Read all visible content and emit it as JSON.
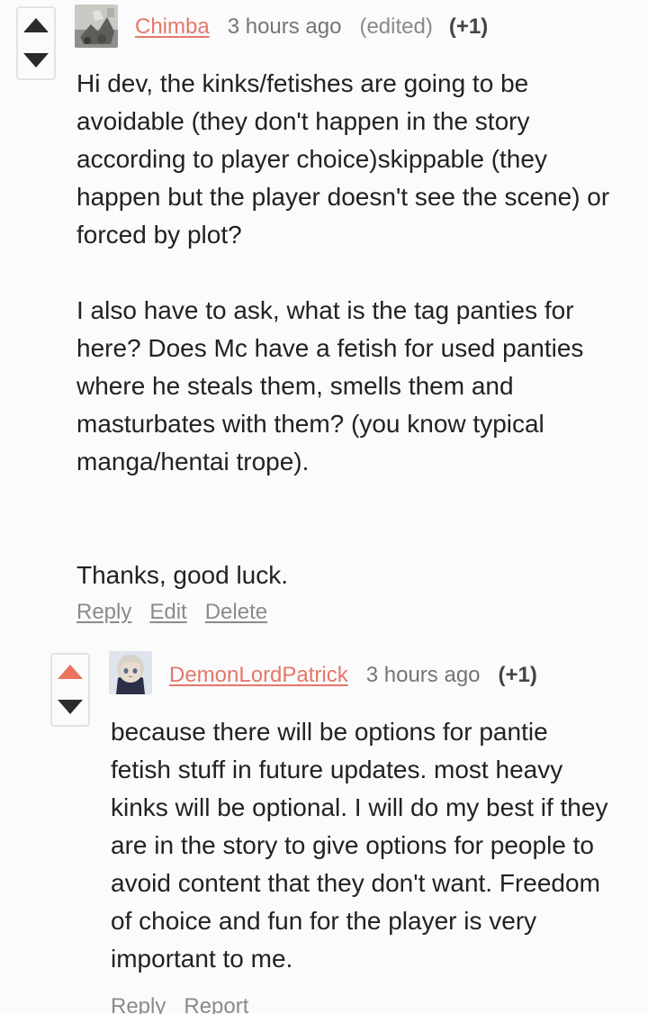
{
  "comments": [
    {
      "username": "Chimba",
      "time": "3 hours ago",
      "edited": "(edited)",
      "score": "(+1)",
      "avatar_icon": "user-photo-icon",
      "paragraphs": [
        "Hi dev, the kinks/fetishes are going to be avoidable (they don't happen in the story according to player choice)skippable (they happen but the player doesn't see the scene) or forced by plot?",
        "I also have to ask, what is the tag panties for here? Does Mc have a fetish for used panties where he steals them, smells them and masturbates with them? (you know typical manga/hentai trope).",
        "Thanks, good luck."
      ],
      "actions": [
        "Reply",
        "Edit",
        "Delete"
      ]
    },
    {
      "username": "DemonLordPatrick",
      "time": "3 hours ago",
      "score": "(+1)",
      "avatar_icon": "anime-character-icon",
      "upvoted": true,
      "paragraphs": [
        "because there will be options for pantie fetish stuff in future updates. most heavy kinks will be optional. I will do my best if they are in the story to give options for people to avoid content that they don't want. Freedom of choice and fun for the player is very important to me."
      ],
      "actions": [
        "Reply",
        "Report"
      ]
    }
  ],
  "colors": {
    "username": "#e3786a",
    "upvote_active": "#e9735e",
    "muted": "#8b8b8b"
  }
}
